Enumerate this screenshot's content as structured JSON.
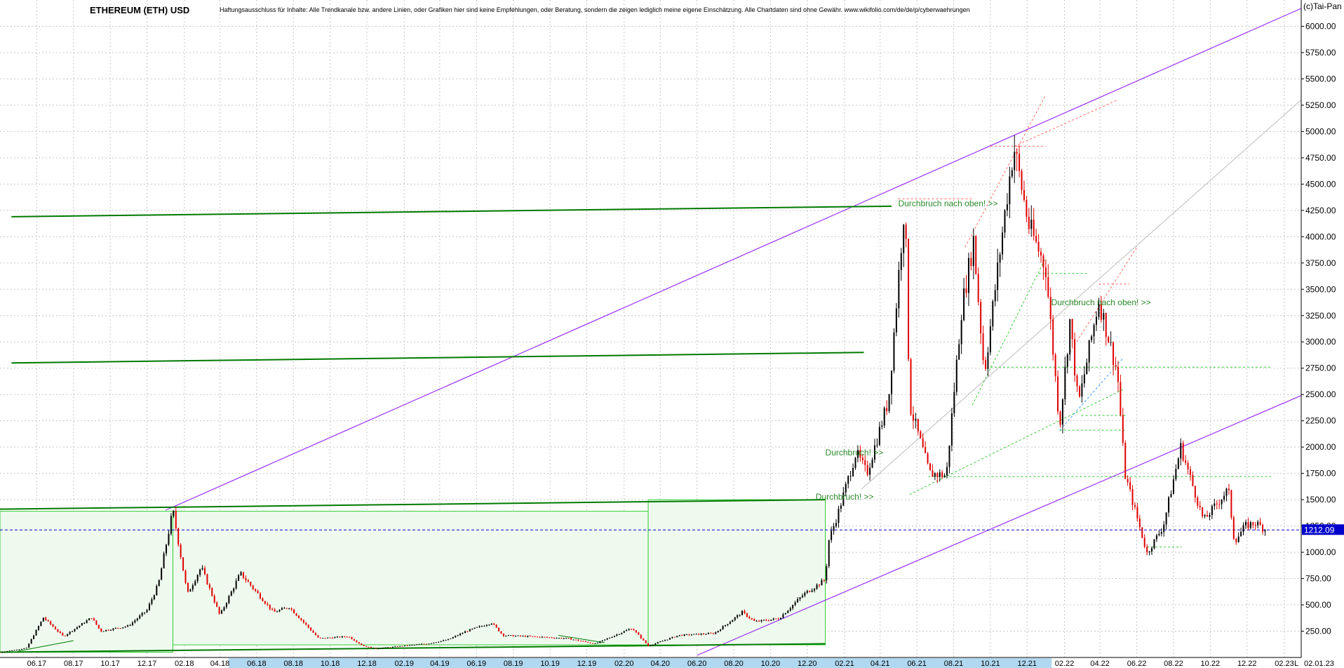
{
  "header": {
    "title": "ETHEREUM (ETH) USD",
    "disclaimer": "Haftungsausschluss für Inhalte: Alle Trendkanale bzw. andere Linien, oder Grafiken hier sind keine Empfehlungen, oder Beratung, sondern die zeigen lediglich meine eigene Einschätzung. Alle Chartdaten sind ohne Gewähr. www.wikifolio.com/de/de/p/cyberwaehrungen",
    "copyright": "(c)Tai-Pan"
  },
  "chart_data": {
    "type": "candlestick",
    "title": "ETHEREUM (ETH) USD",
    "ylim": [
      0,
      6250
    ],
    "yticks": [
      250,
      500,
      750,
      1000,
      1250,
      1500,
      1750,
      2000,
      2250,
      2500,
      2750,
      3000,
      3250,
      3500,
      3750,
      4000,
      4250,
      4500,
      4750,
      5000,
      5250,
      5500,
      5750,
      6000
    ],
    "ytick_labels": [
      "250.00",
      "500.00",
      "750.00",
      "1000.00",
      "1250.00",
      "1500.00",
      "1750.00",
      "2000.00",
      "2250.00",
      "2500.00",
      "2750.00",
      "3000.00",
      "3250.00",
      "3500.00",
      "3750.00",
      "4000.00",
      "4250.00",
      "4500.00",
      "4750.00",
      "5000.00",
      "5250.00",
      "5500.00",
      "5750.00",
      "6000.00"
    ],
    "xlim": [
      "2017-04",
      "2023-03"
    ],
    "xticks": [
      "2017-06",
      "2017-08",
      "2017-10",
      "2017-12",
      "2018-02",
      "2018-04",
      "2018-06",
      "2018-08",
      "2018-10",
      "2018-12",
      "2019-02",
      "2019-04",
      "2019-06",
      "2019-08",
      "2019-10",
      "2019-12",
      "2020-02",
      "2020-04",
      "2020-06",
      "2020-08",
      "2020-10",
      "2020-12",
      "2021-02",
      "2021-04",
      "2021-06",
      "2021-08",
      "2021-10",
      "2021-12",
      "2022-02",
      "2022-04",
      "2022-06",
      "2022-08",
      "2022-10",
      "2022-12",
      "2023-02"
    ],
    "xtick_labels": [
      "06.17",
      "08.17",
      "10.17",
      "12.17",
      "02.18",
      "04.18",
      "06.18",
      "08.18",
      "10.18",
      "12.18",
      "02.19",
      "04.19",
      "06.19",
      "08.19",
      "10.19",
      "12.19",
      "02.20",
      "04.20",
      "06.20",
      "08.20",
      "10.20",
      "12.20",
      "02.21",
      "04.21",
      "06.21",
      "08.21",
      "10.21",
      "12.21",
      "02.22",
      "04.22",
      "06.22",
      "08.22",
      "10.22",
      "12.22",
      "02.23"
    ],
    "x_end_label": "02.01.23",
    "x_end_marker": "L",
    "current_price": 1212.09,
    "current_price_label": "1212.09",
    "price_path": [
      [
        "2017-04-01",
        50
      ],
      [
        "2017-05-15",
        90
      ],
      [
        "2017-06-12",
        380
      ],
      [
        "2017-07-15",
        200
      ],
      [
        "2017-08-31",
        380
      ],
      [
        "2017-09-15",
        250
      ],
      [
        "2017-10-31",
        300
      ],
      [
        "2017-12-01",
        450
      ],
      [
        "2017-12-20",
        700
      ],
      [
        "2018-01-13",
        1400
      ],
      [
        "2018-02-06",
        600
      ],
      [
        "2018-03-01",
        860
      ],
      [
        "2018-04-01",
        400
      ],
      [
        "2018-05-05",
        800
      ],
      [
        "2018-06-29",
        430
      ],
      [
        "2018-07-25",
        480
      ],
      [
        "2018-09-12",
        180
      ],
      [
        "2018-10-31",
        200
      ],
      [
        "2018-11-25",
        110
      ],
      [
        "2018-12-15",
        85
      ],
      [
        "2019-01-31",
        110
      ],
      [
        "2019-03-15",
        135
      ],
      [
        "2019-04-15",
        170
      ],
      [
        "2019-05-15",
        250
      ],
      [
        "2019-06-26",
        330
      ],
      [
        "2019-07-15",
        210
      ],
      [
        "2019-09-15",
        195
      ],
      [
        "2019-10-31",
        180
      ],
      [
        "2019-12-15",
        130
      ],
      [
        "2020-02-14",
        280
      ],
      [
        "2020-03-12",
        110
      ],
      [
        "2020-05-01",
        210
      ],
      [
        "2020-06-30",
        230
      ],
      [
        "2020-08-15",
        430
      ],
      [
        "2020-09-05",
        340
      ],
      [
        "2020-10-15",
        370
      ],
      [
        "2020-11-25",
        600
      ],
      [
        "2020-12-31",
        740
      ],
      [
        "2021-01-05",
        1100
      ],
      [
        "2021-01-20",
        1350
      ],
      [
        "2021-02-20",
        1950
      ],
      [
        "2021-03-10",
        1750
      ],
      [
        "2021-04-15",
        2450
      ],
      [
        "2021-05-12",
        4360
      ],
      [
        "2021-05-20",
        2400
      ],
      [
        "2021-06-22",
        1750
      ],
      [
        "2021-07-20",
        1730
      ],
      [
        "2021-08-14",
        3300
      ],
      [
        "2021-09-03",
        3970
      ],
      [
        "2021-09-21",
        2700
      ],
      [
        "2021-10-29",
        4400
      ],
      [
        "2021-11-09",
        4860
      ],
      [
        "2021-12-04",
        4100
      ],
      [
        "2022-01-01",
        3700
      ],
      [
        "2022-01-24",
        2200
      ],
      [
        "2022-02-10",
        3200
      ],
      [
        "2022-02-24",
        2400
      ],
      [
        "2022-03-30",
        3400
      ],
      [
        "2022-04-30",
        2700
      ],
      [
        "2022-05-12",
        1750
      ],
      [
        "2022-06-18",
        990
      ],
      [
        "2022-07-15",
        1250
      ],
      [
        "2022-08-13",
        2000
      ],
      [
        "2022-09-20",
        1300
      ],
      [
        "2022-10-31",
        1600
      ],
      [
        "2022-11-10",
        1100
      ],
      [
        "2022-11-28",
        1250
      ],
      [
        "2022-12-15",
        1280
      ],
      [
        "2023-01-02",
        1212
      ]
    ],
    "annotations": [
      {
        "text": "Durchbruch nach oben! >>",
        "date": "2021-05-01",
        "price": 4290
      },
      {
        "text": "Durchbruch nach oben! >>",
        "date": "2022-01-10",
        "price": 3350
      },
      {
        "text": "Durchbruch! >>",
        "date": "2020-12-31",
        "price": 1920
      },
      {
        "text": "Durchbruch! >>",
        "date": "2020-12-15",
        "price": 1500
      }
    ],
    "colors": {
      "candle_up": "#000000",
      "candle_down": "#e00000",
      "channel_purple": "#9b30ff",
      "channel_green": "#007a00",
      "box_green": "#33cc33",
      "dotted_green": "#33cc33",
      "dotted_red": "#ff6666",
      "dotted_blue": "#3399ff",
      "price_line": "#0000cc",
      "grid": "#c8c8c8",
      "xaxis_bg": "#b0d8f0"
    }
  }
}
